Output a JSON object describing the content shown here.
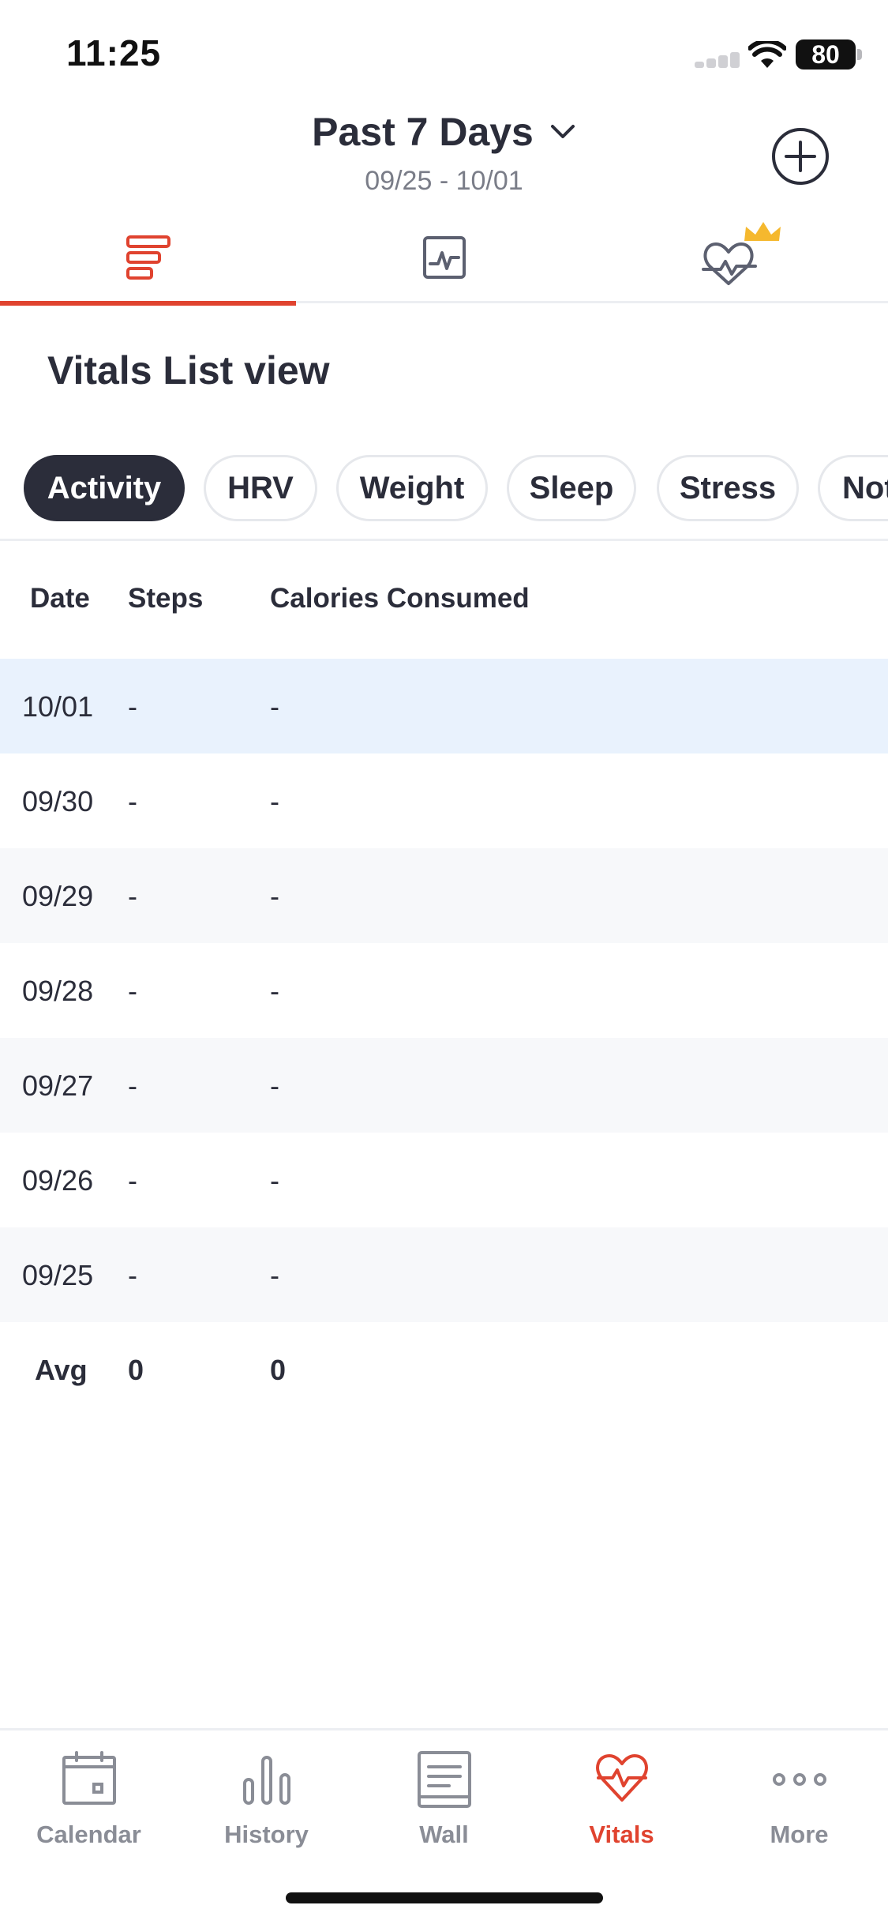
{
  "status_bar": {
    "time": "11:25",
    "battery": "80"
  },
  "header": {
    "title": "Past 7 Days",
    "date_range": "09/25 - 10/01"
  },
  "tabs": [
    {
      "icon": "list-view-icon",
      "active": true
    },
    {
      "icon": "chart-view-icon",
      "active": false
    },
    {
      "icon": "premium-heart-icon",
      "active": false
    }
  ],
  "section_title": "Vitals List view",
  "filters": [
    {
      "label": "Activity",
      "active": true
    },
    {
      "label": "HRV",
      "active": false
    },
    {
      "label": "Weight",
      "active": false
    },
    {
      "label": "Sleep",
      "active": false
    },
    {
      "label": "Stress",
      "active": false
    },
    {
      "label": "Not",
      "active": false
    }
  ],
  "table": {
    "headers": [
      "Date",
      "Steps",
      "Calories Consumed"
    ],
    "rows": [
      {
        "date": "10/01",
        "steps": "-",
        "calories": "-"
      },
      {
        "date": "09/30",
        "steps": "-",
        "calories": "-"
      },
      {
        "date": "09/29",
        "steps": "-",
        "calories": "-"
      },
      {
        "date": "09/28",
        "steps": "-",
        "calories": "-"
      },
      {
        "date": "09/27",
        "steps": "-",
        "calories": "-"
      },
      {
        "date": "09/26",
        "steps": "-",
        "calories": "-"
      },
      {
        "date": "09/25",
        "steps": "-",
        "calories": "-"
      }
    ],
    "avg": {
      "label": "Avg",
      "steps": "0",
      "calories": "0"
    }
  },
  "bottom_nav": [
    {
      "label": "Calendar",
      "icon": "calendar-icon",
      "active": false
    },
    {
      "label": "History",
      "icon": "bar-chart-icon",
      "active": false
    },
    {
      "label": "Wall",
      "icon": "wall-icon",
      "active": false
    },
    {
      "label": "Vitals",
      "icon": "heart-pulse-icon",
      "active": true
    },
    {
      "label": "More",
      "icon": "more-dots-icon",
      "active": false
    }
  ],
  "colors": {
    "accent": "#e0432f",
    "dark": "#2b2d3a",
    "highlight_row": "#e9f2fd",
    "alt_row": "#f7f8fa",
    "crown": "#f5b82e"
  }
}
